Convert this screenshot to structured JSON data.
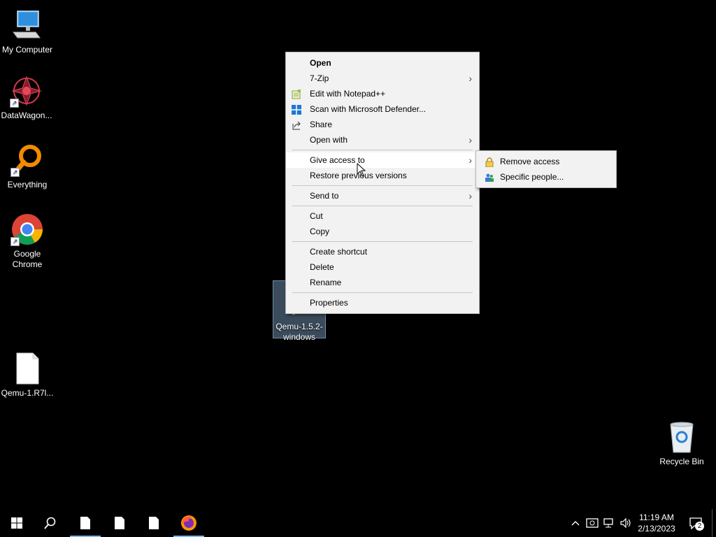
{
  "desktop": {
    "icons": [
      {
        "label": "My Computer"
      },
      {
        "label": "DataWagon..."
      },
      {
        "label": "Everything"
      },
      {
        "label": "Google Chrome"
      },
      {
        "label": "Qemu-1.R7l..."
      },
      {
        "label": "Qemu-1.5.2-windows"
      },
      {
        "label": "Recycle Bin"
      }
    ]
  },
  "context_menu": {
    "items": [
      {
        "label": "Open"
      },
      {
        "label": "7-Zip"
      },
      {
        "label": "Edit with Notepad++"
      },
      {
        "label": "Scan with Microsoft Defender..."
      },
      {
        "label": "Share"
      },
      {
        "label": "Open with"
      },
      {
        "label": "Give access to"
      },
      {
        "label": "Restore previous versions"
      },
      {
        "label": "Send to"
      },
      {
        "label": "Cut"
      },
      {
        "label": "Copy"
      },
      {
        "label": "Create shortcut"
      },
      {
        "label": "Delete"
      },
      {
        "label": "Rename"
      },
      {
        "label": "Properties"
      }
    ]
  },
  "submenu": {
    "items": [
      {
        "label": "Remove access"
      },
      {
        "label": "Specific people..."
      }
    ]
  },
  "taskbar": {
    "time": "11:19 AM",
    "date": "2/13/2023",
    "notification_count": "2"
  }
}
